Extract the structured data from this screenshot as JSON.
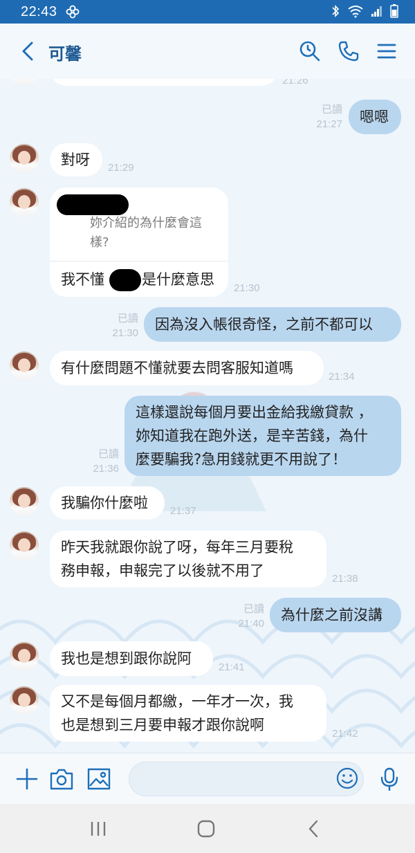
{
  "status_bar": {
    "time": "22:43"
  },
  "header": {
    "contact_name": "可馨"
  },
  "messages": [
    {
      "side": "mine",
      "text": "嗯嗯",
      "read": "已讀",
      "time": "21:27"
    },
    {
      "side": "theirs",
      "text": "對呀",
      "time": "21:29"
    },
    {
      "side": "theirs",
      "reply_quote": "妳介紹的為什麼會這樣?",
      "text_before": "我不懂",
      "text_after": "是什麼意思",
      "time": "21:30"
    },
    {
      "side": "mine",
      "text": "因為沒入帳很奇怪，之前不都可以",
      "read": "已讀",
      "time": "21:30"
    },
    {
      "side": "theirs",
      "text": "有什麼問題不懂就要去問客服知道嗎",
      "time": "21:34"
    },
    {
      "side": "mine",
      "lines": [
        "這樣還說每個月要出金給我繳貸款 ，",
        "妳知道我在跑外送，是辛苦錢，為什",
        "麼要騙我?急用錢就更不用說了！"
      ],
      "read": "已讀",
      "time": "21:36"
    },
    {
      "side": "theirs",
      "text": "我騙你什麼啦",
      "time": "21:37"
    },
    {
      "side": "theirs",
      "lines": [
        "昨天我就跟你說了呀，每年三月要稅",
        "務申報，申報完了以後就不用了"
      ],
      "time": "21:38"
    },
    {
      "side": "mine",
      "text": "為什麼之前沒講",
      "read": "已讀",
      "time": "21:40"
    },
    {
      "side": "theirs",
      "text": "我也是想到跟你說阿",
      "time": "21:41"
    },
    {
      "side": "theirs",
      "lines": [
        "又不是每個月都繳，一年才一次，我",
        "也是想到三月要申報才跟你說啊"
      ],
      "time": "21:42"
    }
  ],
  "top_partial_time": "21:26",
  "input": {
    "placeholder": ""
  },
  "icons": {
    "status": [
      "pinwheel-icon",
      "bluetooth-icon",
      "wifi-icon",
      "signal-icon",
      "battery-icon"
    ],
    "header": [
      "back-arrow-icon",
      "search-icon",
      "phone-icon",
      "menu-icon"
    ],
    "input": [
      "plus-icon",
      "camera-icon",
      "image-icon",
      "emoji-icon",
      "microphone-icon"
    ],
    "nav": [
      "recents-icon",
      "home-icon",
      "back-icon"
    ]
  },
  "colors": {
    "status_bar": "#1f6bb3",
    "my_bubble": "#b9d6ef",
    "their_bubble": "#ffffff",
    "accent": "#1e6fb8"
  }
}
